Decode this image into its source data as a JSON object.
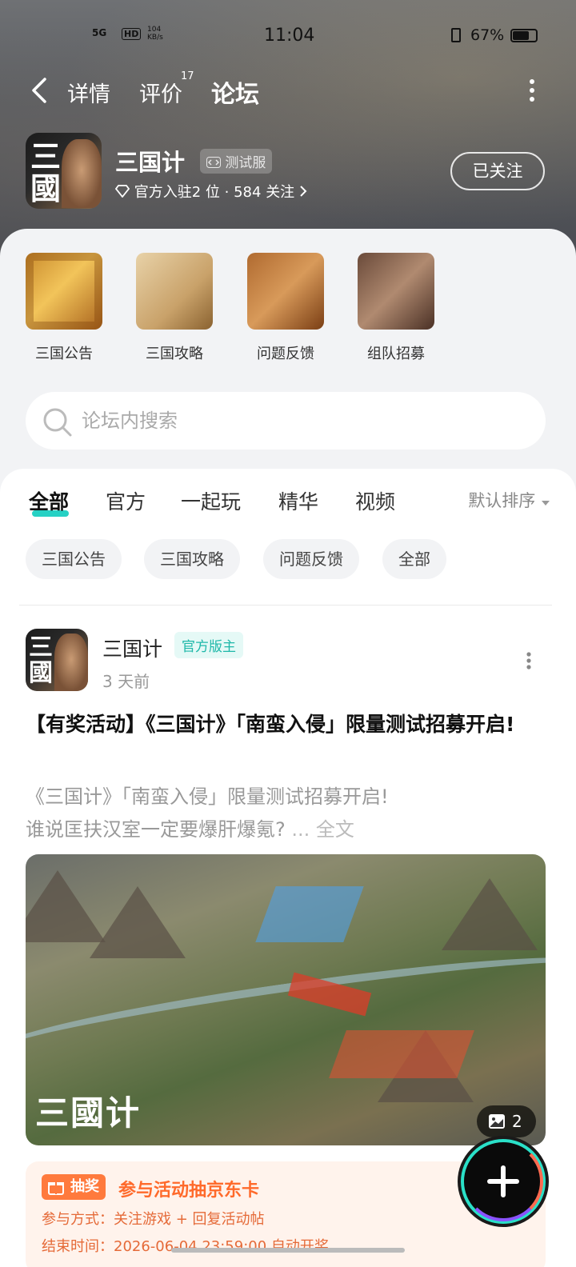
{
  "status_bar": {
    "signal": "5G",
    "hd": "HD",
    "speed": "104\nKB/s",
    "time": "11:04",
    "battery": "67%"
  },
  "nav": {
    "tabs": [
      {
        "label": "详情"
      },
      {
        "label": "评价",
        "badge": "17"
      },
      {
        "label": "论坛"
      }
    ],
    "active_tab": "论坛"
  },
  "app": {
    "name": "三国计",
    "icon_text": "三\n國",
    "tag": "测试服",
    "official_count": "官方入驻2 位",
    "followers": "584 关注",
    "follow_button": "已关注"
  },
  "quick_entries": [
    {
      "label": "三国公告"
    },
    {
      "label": "三国攻略"
    },
    {
      "label": "问题反馈"
    },
    {
      "label": "组队招募"
    }
  ],
  "search": {
    "placeholder": "论坛内搜索"
  },
  "feed_tabs": [
    {
      "label": "全部"
    },
    {
      "label": "官方"
    },
    {
      "label": "一起玩"
    },
    {
      "label": "精华"
    },
    {
      "label": "视频"
    }
  ],
  "sort_label": "默认排序",
  "chips": [
    {
      "label": "三国公告"
    },
    {
      "label": "三国攻略"
    },
    {
      "label": "问题反馈"
    },
    {
      "label": "全部"
    }
  ],
  "post": {
    "author": "三国计",
    "role": "官方版主",
    "time": "3 天前",
    "title": "【有奖活动】《三国计》「南蛮入侵」限量测试招募开启!",
    "body_line1": "《三国计》「南蛮入侵」限量测试招募开启!",
    "body_line2": "谁说匡扶汉室一定要爆肝爆氪?",
    "full_text": "... 全文",
    "image_logo": "三國计",
    "image_count": "2",
    "promo": {
      "tag": "抽奖",
      "title": "参与活动抽京东卡",
      "method": "参与方式：关注游戏 + 回复活动帖",
      "end_time": "结束时间：2026-06-04 23:59:00 自动开奖"
    }
  },
  "colors": {
    "accent": "#26d1c4",
    "promo": "#ff6a2b"
  }
}
